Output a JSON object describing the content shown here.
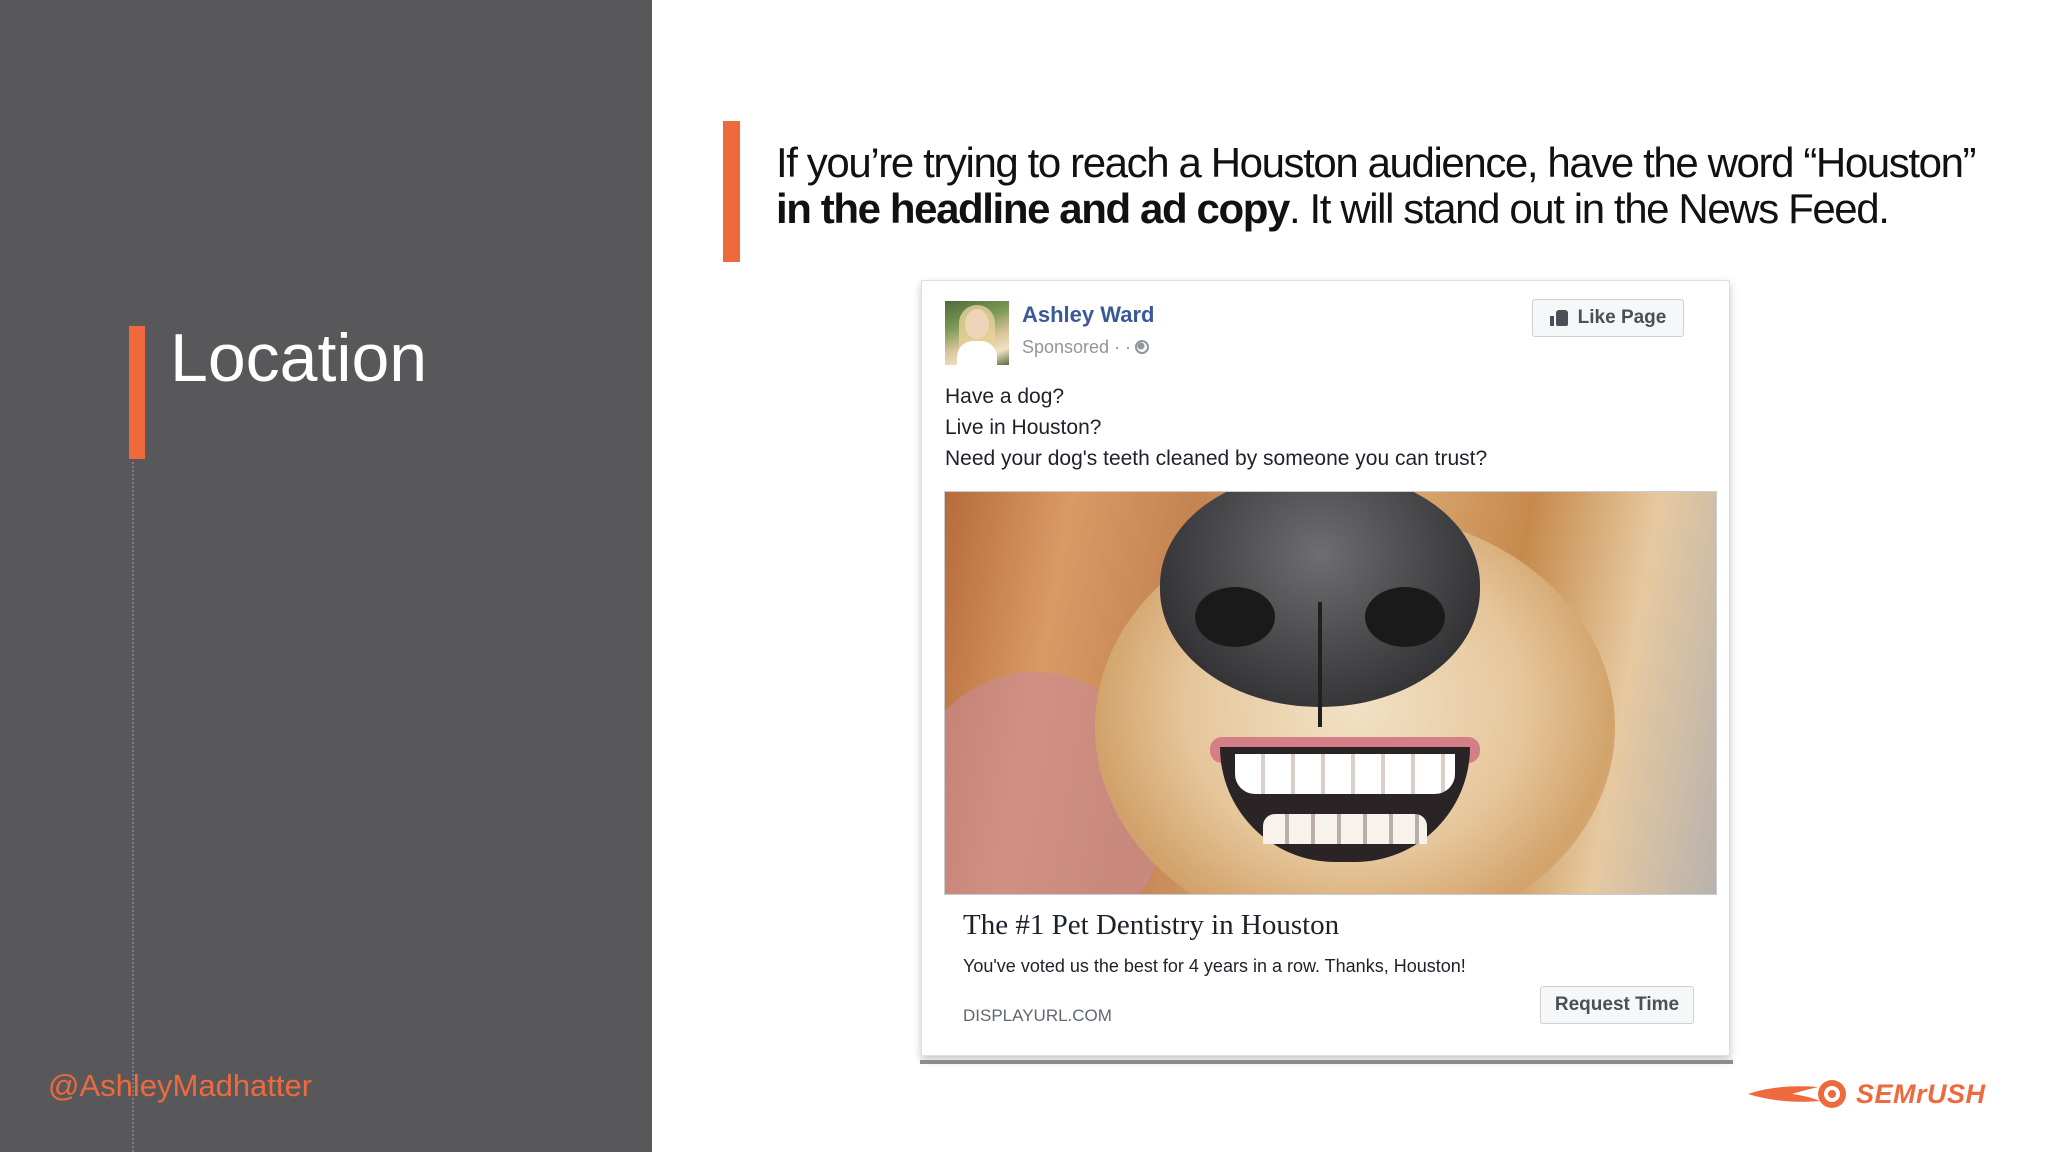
{
  "slide": {
    "section_title": "Location",
    "handle": "@AshleyMadhatter",
    "quote_normal_1": "If you’re trying to reach a Houston audience, have the word “Houston” ",
    "quote_bold": "in the headline and ad copy",
    "quote_normal_2": ". It will stand out in the News Feed.",
    "accent_color": "#ee6a3d",
    "panel_color": "#58585b"
  },
  "ad": {
    "page_name": "Ashley Ward",
    "sponsored": "Sponsored · ·",
    "like_button": "Like Page",
    "copy_lines": [
      "Have a dog?",
      "Live in Houston?",
      "Need your dog's teeth cleaned by someone you can trust?"
    ],
    "headline": "The #1 Pet Dentistry in Houston",
    "description": "You've voted us the best for 4 years in a row. Thanks, Houston!",
    "display_url": "DISPLAYURL.COM",
    "cta_button": "Request Time",
    "name_color": "#3b5998"
  },
  "logo": {
    "text": "SEMrUSH",
    "icon": "semrush-fireball-icon"
  }
}
